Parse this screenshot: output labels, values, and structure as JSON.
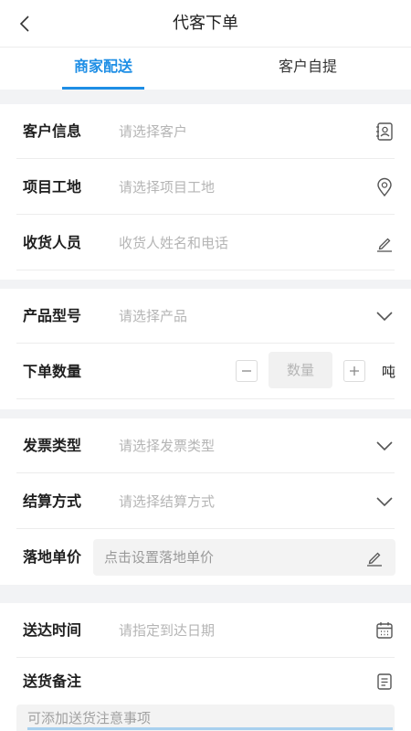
{
  "header": {
    "title": "代客下单",
    "back_icon": "chevron-left-icon"
  },
  "tabs": [
    {
      "label": "商家配送",
      "active": true
    },
    {
      "label": "客户自提",
      "active": false
    }
  ],
  "accent_color": "#1e8ee5",
  "customer_section": {
    "customer": {
      "label": "客户信息",
      "placeholder": "请选择客户",
      "icon": "contact-book-icon"
    },
    "site": {
      "label": "项目工地",
      "placeholder": "请选择项目工地",
      "icon": "location-pin-icon"
    },
    "receiver": {
      "label": "收货人员",
      "placeholder": "收货人姓名和电话",
      "icon": "edit-pen-icon"
    }
  },
  "product_section": {
    "product": {
      "label": "产品型号",
      "placeholder": "请选择产品",
      "icon": "chevron-down-icon"
    },
    "quantity": {
      "label": "下单数量",
      "placeholder": "数量",
      "unit": "吨"
    }
  },
  "billing_section": {
    "invoice": {
      "label": "发票类型",
      "placeholder": "请选择发票类型",
      "icon": "chevron-down-icon"
    },
    "settlement": {
      "label": "结算方式",
      "placeholder": "请选择结算方式",
      "icon": "chevron-down-icon"
    },
    "landing_price": {
      "label": "落地单价",
      "placeholder": "点击设置落地单价",
      "icon": "edit-pen-icon"
    }
  },
  "delivery_section": {
    "time": {
      "label": "送达时间",
      "placeholder": "请指定到达日期",
      "icon": "calendar-icon"
    },
    "remark": {
      "label": "送货备注",
      "placeholder": "可添加送货注意事项",
      "icon": "note-icon"
    }
  }
}
